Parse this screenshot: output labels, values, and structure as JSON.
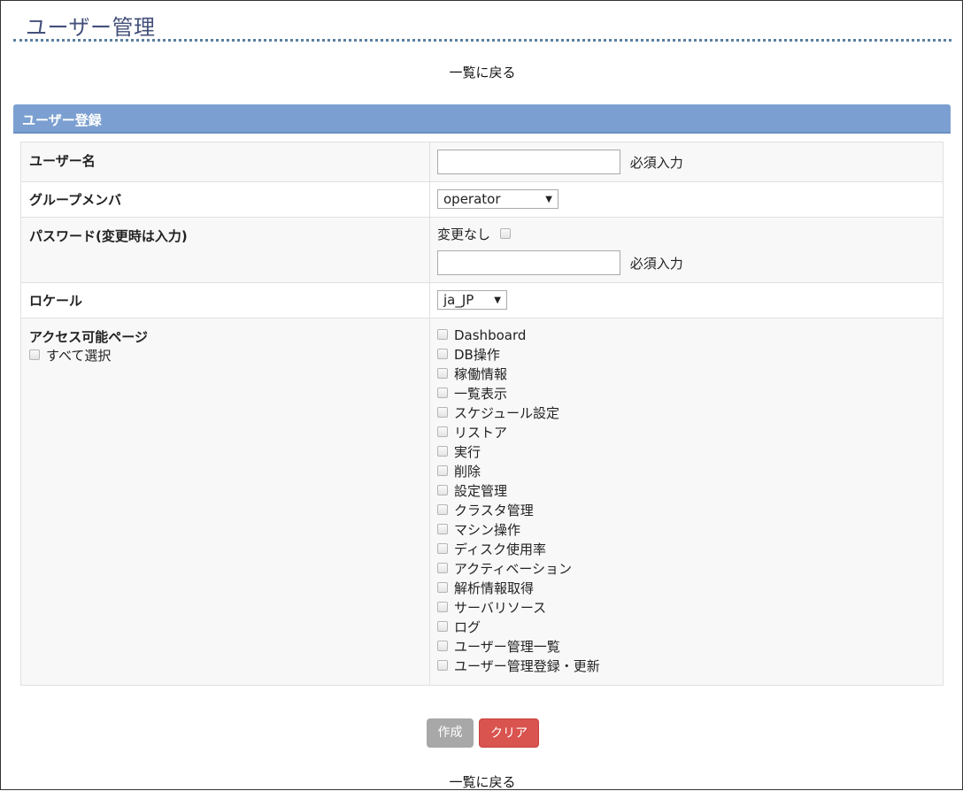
{
  "page": {
    "title": "ユーザー管理",
    "back_link": "一覧に戻る"
  },
  "section": {
    "title": "ユーザー登録"
  },
  "form": {
    "username": {
      "label": "ユーザー名",
      "value": "",
      "required": "必須入力"
    },
    "group": {
      "label": "グループメンバ",
      "selected": "operator"
    },
    "password": {
      "label": "パスワード(変更時は入力)",
      "no_change_label": "変更なし",
      "value": "",
      "required": "必須入力"
    },
    "locale": {
      "label": "ロケール",
      "selected": "ja_JP"
    },
    "pages": {
      "label": "アクセス可能ページ",
      "select_all": "すべて選択",
      "items": [
        "Dashboard",
        "DB操作",
        "稼働情報",
        "一覧表示",
        "スケジュール設定",
        "リストア",
        "実行",
        "削除",
        "設定管理",
        "クラスタ管理",
        "マシン操作",
        "ディスク使用率",
        "アクティベーション",
        "解析情報取得",
        "サーバリソース",
        "ログ",
        "ユーザー管理一覧",
        "ユーザー管理登録・更新"
      ]
    }
  },
  "buttons": {
    "create": "作成",
    "clear": "クリア"
  },
  "colors": {
    "header_bg": "#7b9fd0",
    "clear_btn": "#d9534f",
    "create_btn": "#a8a8a8",
    "title_color": "#44507a"
  }
}
